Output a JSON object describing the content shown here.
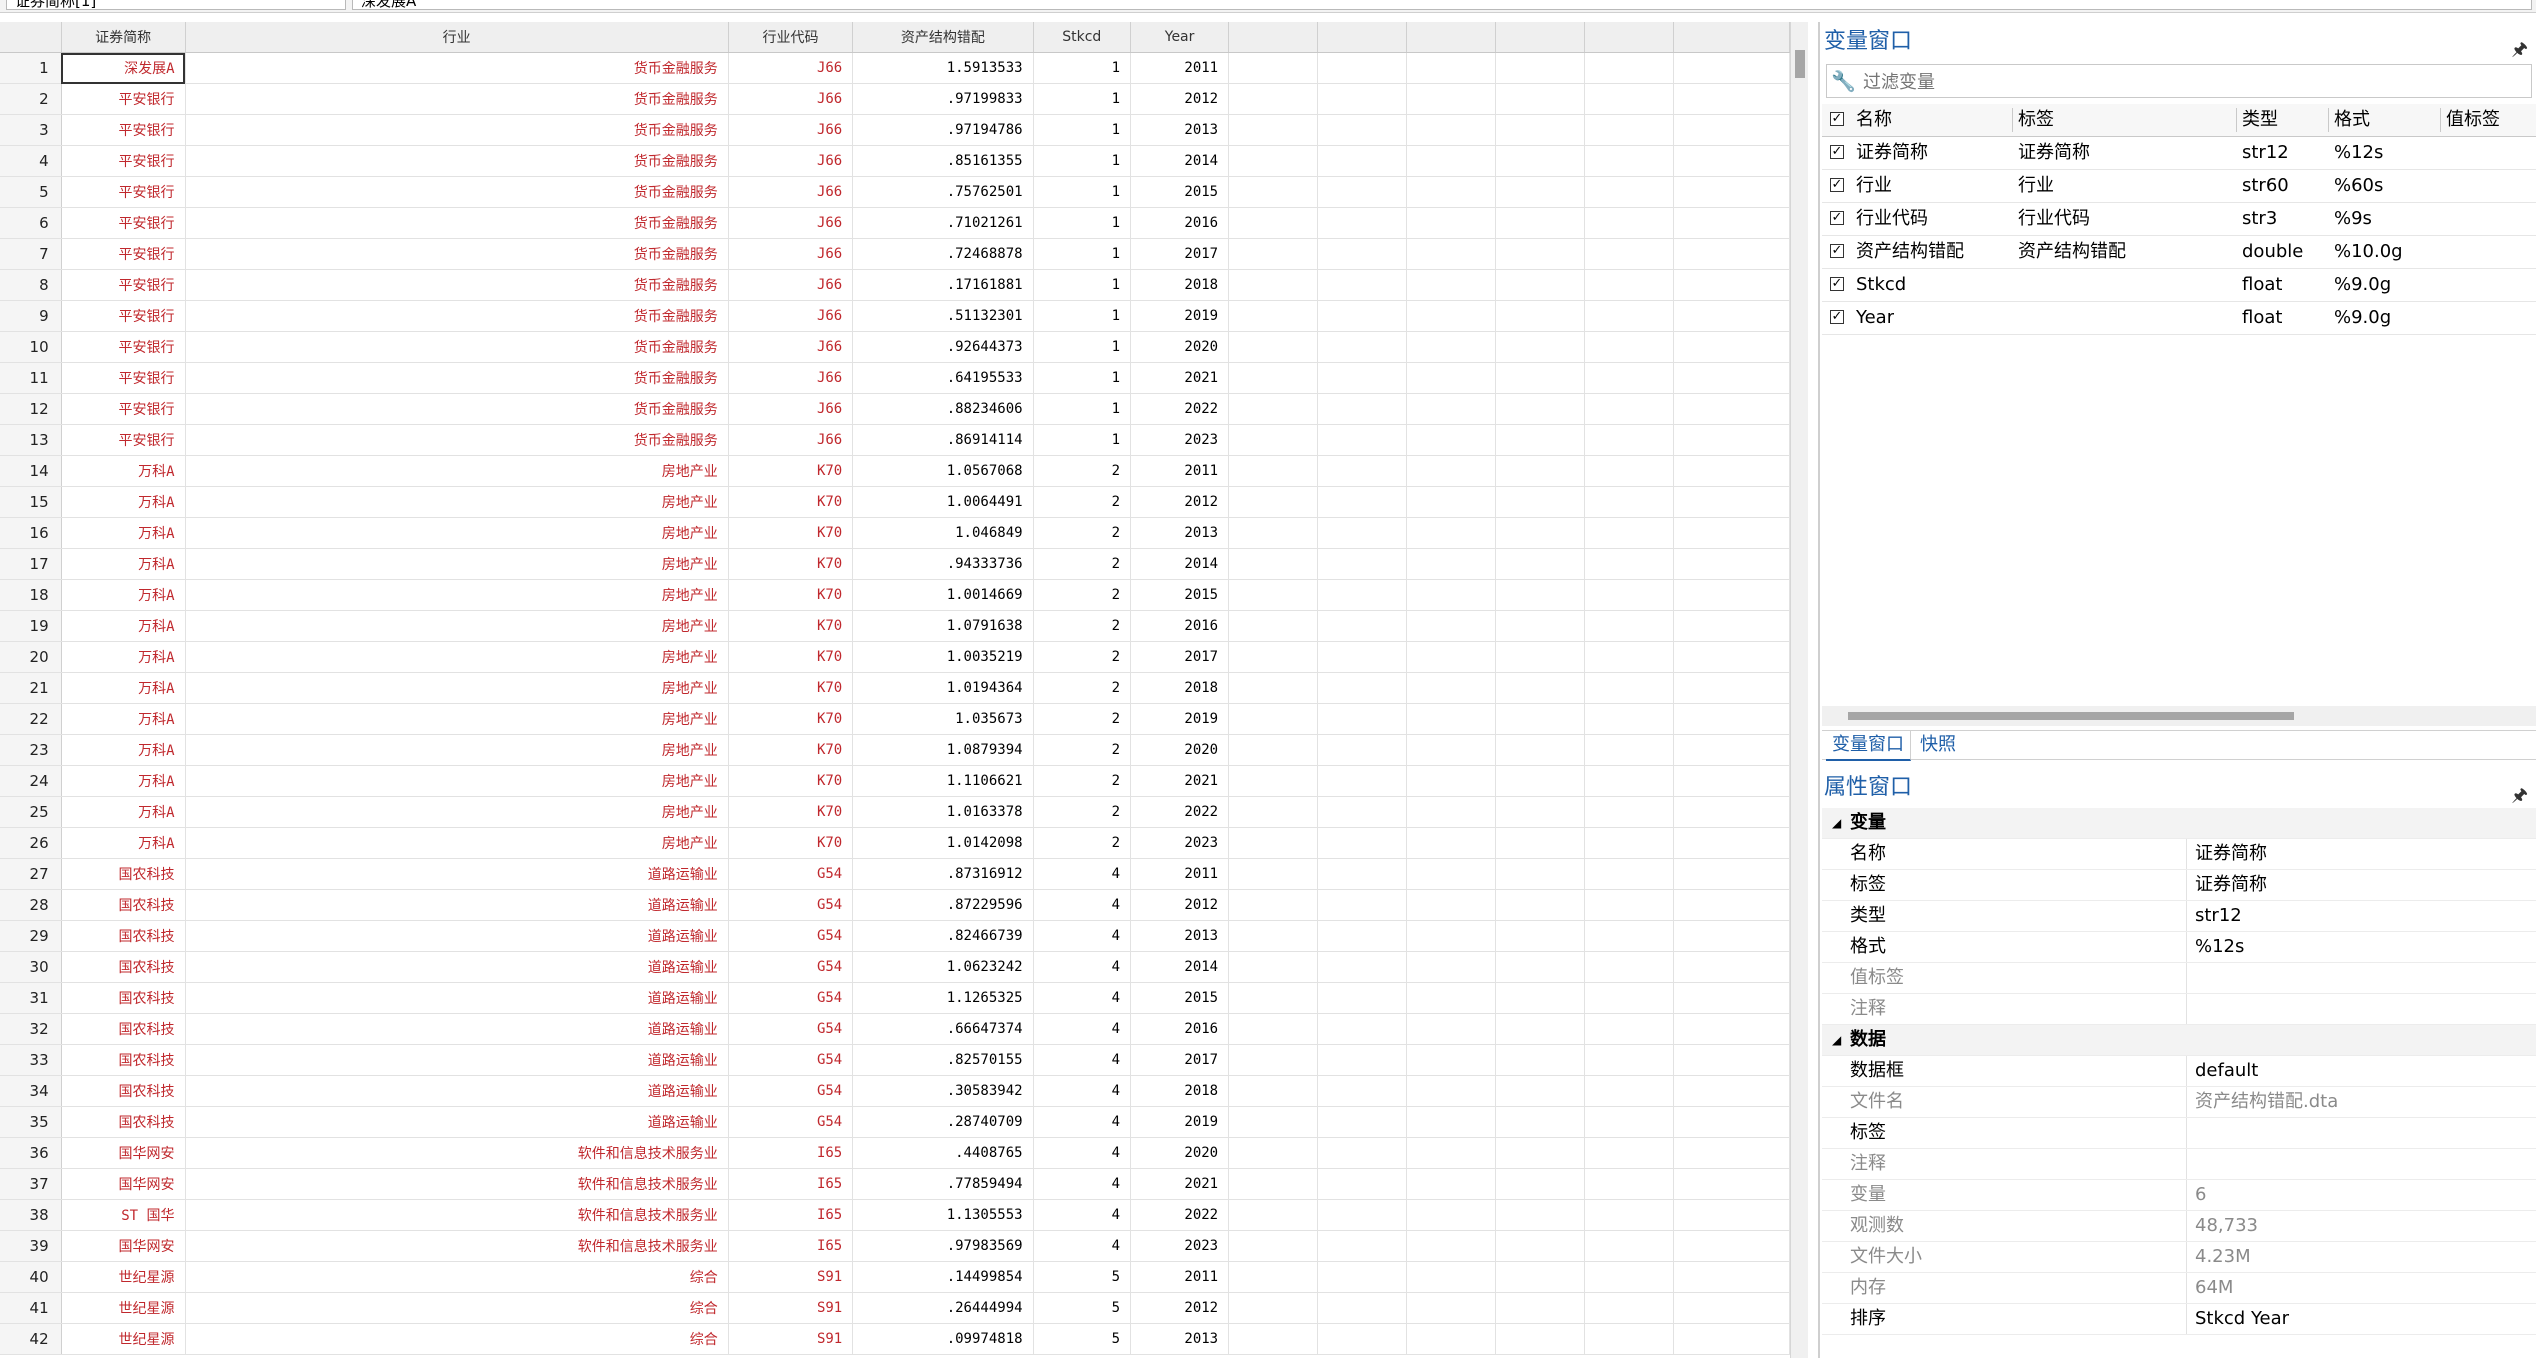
{
  "varname_box": "证券简称[1]",
  "value_box": "深发展A",
  "grid": {
    "columns": [
      "证券简称",
      "行业",
      "行业代码",
      "资产结构错配",
      "Stkcd",
      "Year"
    ],
    "rows": [
      [
        "1",
        "深发展A",
        "货币金融服务",
        "J66",
        "1.5913533",
        "1",
        "2011"
      ],
      [
        "2",
        "平安银行",
        "货币金融服务",
        "J66",
        ".97199833",
        "1",
        "2012"
      ],
      [
        "3",
        "平安银行",
        "货币金融服务",
        "J66",
        ".97194786",
        "1",
        "2013"
      ],
      [
        "4",
        "平安银行",
        "货币金融服务",
        "J66",
        ".85161355",
        "1",
        "2014"
      ],
      [
        "5",
        "平安银行",
        "货币金融服务",
        "J66",
        ".75762501",
        "1",
        "2015"
      ],
      [
        "6",
        "平安银行",
        "货币金融服务",
        "J66",
        ".71021261",
        "1",
        "2016"
      ],
      [
        "7",
        "平安银行",
        "货币金融服务",
        "J66",
        ".72468878",
        "1",
        "2017"
      ],
      [
        "8",
        "平安银行",
        "货币金融服务",
        "J66",
        ".17161881",
        "1",
        "2018"
      ],
      [
        "9",
        "平安银行",
        "货币金融服务",
        "J66",
        ".51132301",
        "1",
        "2019"
      ],
      [
        "10",
        "平安银行",
        "货币金融服务",
        "J66",
        ".92644373",
        "1",
        "2020"
      ],
      [
        "11",
        "平安银行",
        "货币金融服务",
        "J66",
        ".64195533",
        "1",
        "2021"
      ],
      [
        "12",
        "平安银行",
        "货币金融服务",
        "J66",
        ".88234606",
        "1",
        "2022"
      ],
      [
        "13",
        "平安银行",
        "货币金融服务",
        "J66",
        ".86914114",
        "1",
        "2023"
      ],
      [
        "14",
        "万科A",
        "房地产业",
        "K70",
        "1.0567068",
        "2",
        "2011"
      ],
      [
        "15",
        "万科A",
        "房地产业",
        "K70",
        "1.0064491",
        "2",
        "2012"
      ],
      [
        "16",
        "万科A",
        "房地产业",
        "K70",
        "1.046849",
        "2",
        "2013"
      ],
      [
        "17",
        "万科A",
        "房地产业",
        "K70",
        ".94333736",
        "2",
        "2014"
      ],
      [
        "18",
        "万科A",
        "房地产业",
        "K70",
        "1.0014669",
        "2",
        "2015"
      ],
      [
        "19",
        "万科A",
        "房地产业",
        "K70",
        "1.0791638",
        "2",
        "2016"
      ],
      [
        "20",
        "万科A",
        "房地产业",
        "K70",
        "1.0035219",
        "2",
        "2017"
      ],
      [
        "21",
        "万科A",
        "房地产业",
        "K70",
        "1.0194364",
        "2",
        "2018"
      ],
      [
        "22",
        "万科A",
        "房地产业",
        "K70",
        "1.035673",
        "2",
        "2019"
      ],
      [
        "23",
        "万科A",
        "房地产业",
        "K70",
        "1.0879394",
        "2",
        "2020"
      ],
      [
        "24",
        "万科A",
        "房地产业",
        "K70",
        "1.1106621",
        "2",
        "2021"
      ],
      [
        "25",
        "万科A",
        "房地产业",
        "K70",
        "1.0163378",
        "2",
        "2022"
      ],
      [
        "26",
        "万科A",
        "房地产业",
        "K70",
        "1.0142098",
        "2",
        "2023"
      ],
      [
        "27",
        "国农科技",
        "道路运输业",
        "G54",
        ".87316912",
        "4",
        "2011"
      ],
      [
        "28",
        "国农科技",
        "道路运输业",
        "G54",
        ".87229596",
        "4",
        "2012"
      ],
      [
        "29",
        "国农科技",
        "道路运输业",
        "G54",
        ".82466739",
        "4",
        "2013"
      ],
      [
        "30",
        "国农科技",
        "道路运输业",
        "G54",
        "1.0623242",
        "4",
        "2014"
      ],
      [
        "31",
        "国农科技",
        "道路运输业",
        "G54",
        "1.1265325",
        "4",
        "2015"
      ],
      [
        "32",
        "国农科技",
        "道路运输业",
        "G54",
        ".66647374",
        "4",
        "2016"
      ],
      [
        "33",
        "国农科技",
        "道路运输业",
        "G54",
        ".82570155",
        "4",
        "2017"
      ],
      [
        "34",
        "国农科技",
        "道路运输业",
        "G54",
        ".30583942",
        "4",
        "2018"
      ],
      [
        "35",
        "国农科技",
        "道路运输业",
        "G54",
        ".28740709",
        "4",
        "2019"
      ],
      [
        "36",
        "国华网安",
        "软件和信息技术服务业",
        "I65",
        ".4408765",
        "4",
        "2020"
      ],
      [
        "37",
        "国华网安",
        "软件和信息技术服务业",
        "I65",
        ".77859494",
        "4",
        "2021"
      ],
      [
        "38",
        "ST 国华",
        "软件和信息技术服务业",
        "I65",
        "1.1305553",
        "4",
        "2022"
      ],
      [
        "39",
        "国华网安",
        "软件和信息技术服务业",
        "I65",
        ".97983569",
        "4",
        "2023"
      ],
      [
        "40",
        "世纪星源",
        "综合",
        "S91",
        ".14499854",
        "5",
        "2011"
      ],
      [
        "41",
        "世纪星源",
        "综合",
        "S91",
        ".26444994",
        "5",
        "2012"
      ],
      [
        "42",
        "世纪星源",
        "综合",
        "S91",
        ".09974818",
        "5",
        "2013"
      ]
    ]
  },
  "variables_window": {
    "title": "变量窗口",
    "filter_placeholder": "过滤变量",
    "headers": [
      "名称",
      "标签",
      "类型",
      "格式",
      "值标签"
    ],
    "rows": [
      [
        "证券简称",
        "证券简称",
        "str12",
        "%12s"
      ],
      [
        "行业",
        "行业",
        "str60",
        "%60s"
      ],
      [
        "行业代码",
        "行业代码",
        "str3",
        "%9s"
      ],
      [
        "资产结构错配",
        "资产结构错配",
        "double",
        "%10.0g"
      ],
      [
        "Stkcd",
        "",
        "float",
        "%9.0g"
      ],
      [
        "Year",
        "",
        "float",
        "%9.0g"
      ]
    ],
    "tabs": [
      "变量窗口",
      "快照"
    ]
  },
  "properties_window": {
    "title": "属性窗口",
    "sections": [
      {
        "name": "变量",
        "items": [
          [
            "名称",
            "证券简称",
            false
          ],
          [
            "标签",
            "证券简称",
            false
          ],
          [
            "类型",
            "str12",
            false
          ],
          [
            "格式",
            "%12s",
            false
          ],
          [
            "值标签",
            "",
            true
          ],
          [
            "注释",
            "",
            true
          ]
        ]
      },
      {
        "name": "数据",
        "items": [
          [
            "数据框",
            "default",
            false
          ],
          [
            "文件名",
            "资产结构错配.dta",
            true
          ],
          [
            "标签",
            "",
            false
          ],
          [
            "注释",
            "",
            true
          ],
          [
            "变量",
            "6",
            true
          ],
          [
            "观测数",
            "48,733",
            true
          ],
          [
            "文件大小",
            "4.23M",
            true
          ],
          [
            "内存",
            "64M",
            true
          ],
          [
            "排序",
            "Stkcd Year",
            false
          ]
        ]
      }
    ]
  },
  "colors": {
    "string_text": "#c0282d",
    "accent": "#1f5fa8"
  }
}
